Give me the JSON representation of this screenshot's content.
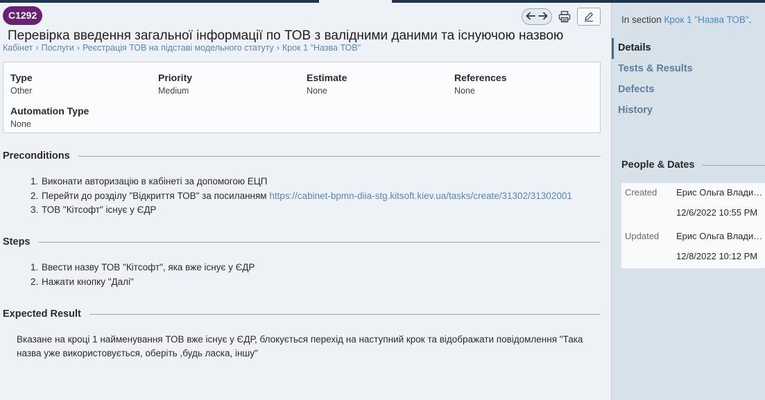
{
  "header": {
    "case_id": "C1292",
    "title": "Перевірка введення загальної інформації по ТОВ з валідними даними та існуючою назвою",
    "breadcrumb": [
      "Кабінет",
      "Послуги",
      "Реєстрація ТОВ на підставі модельного статуту",
      "Крок 1 \"Назва ТОВ\""
    ]
  },
  "fields": {
    "type": {
      "label": "Type",
      "value": "Other"
    },
    "priority": {
      "label": "Priority",
      "value": "Medium"
    },
    "estimate": {
      "label": "Estimate",
      "value": "None"
    },
    "references": {
      "label": "References",
      "value": "None"
    },
    "automation_type": {
      "label": "Automation Type",
      "value": "None"
    }
  },
  "preconditions": {
    "heading": "Preconditions",
    "items": [
      {
        "num": "1.",
        "text": "Виконати авторизацію в кабінеті за допомогою ЕЦП"
      },
      {
        "num": "2.",
        "text": "Перейти до розділу \"Відкриття ТОВ\" за посиланням ",
        "link": "https://cabinet-bpmn-diia-stg.kitsoft.kiev.ua/tasks/create/31302/31302001"
      },
      {
        "num": "3.",
        "text": "ТОВ \"Кітсофт\" існує у ЄДР"
      }
    ]
  },
  "steps": {
    "heading": "Steps",
    "items": [
      {
        "num": "1.",
        "text": "Ввести назву ТОВ \"Кітсофт\", яка вже існує у ЄДР"
      },
      {
        "num": "2.",
        "text": "Нажати кнопку \"Далі\""
      }
    ]
  },
  "expected": {
    "heading": "Expected Result",
    "text": "Вказане на кроці 1 найменування ТОВ вже існує у ЄДР, блокується перехід на наступний крок та відображати повідомлення \"Така назва уже використовується, оберіть ,будь ласка, іншу\""
  },
  "sidebar": {
    "in_section_prefix": "In section ",
    "in_section_link": "Крок 1 \"Назва ТОВ\"",
    "in_section_suffix": ".",
    "tabs": [
      "Details",
      "Tests & Results",
      "Defects",
      "History"
    ],
    "people_dates": {
      "heading": "People & Dates",
      "created_label": "Created",
      "created_by": "Ерис Ольга Владимировна",
      "created_at": "12/6/2022 10:55 PM",
      "updated_label": "Updated",
      "updated_by": "Ерис Ольга Владимировна",
      "updated_at": "12/8/2022 10:12 PM"
    }
  },
  "icons": {
    "nav": "arrow-left-right-icon",
    "print": "printer-icon",
    "edit": "pencil-icon"
  },
  "colors": {
    "case_badge": "#6b2173",
    "link": "#5a86b4",
    "sidebar_bg": "#d6e1ea"
  }
}
